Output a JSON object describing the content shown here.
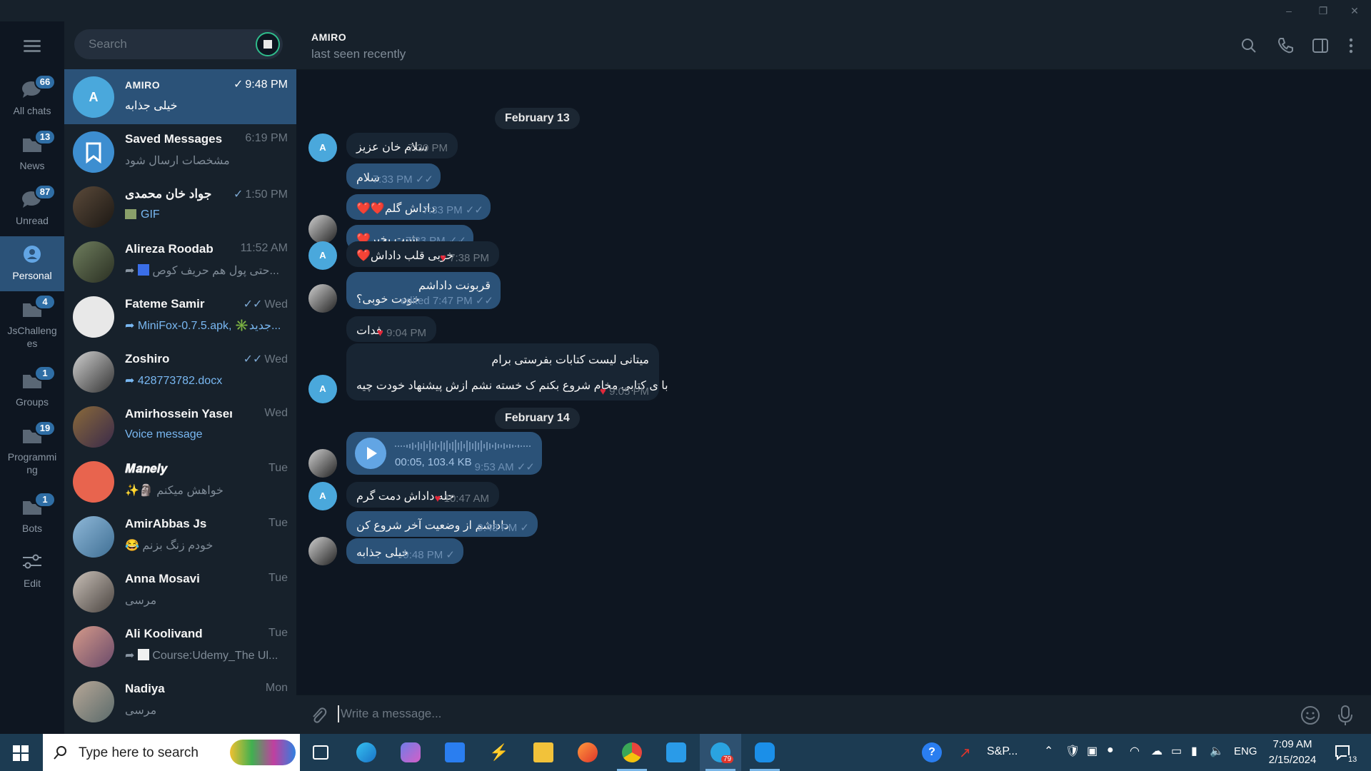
{
  "window": {
    "controls": {
      "minimize": "–",
      "maximize": "❐",
      "close": "✕"
    }
  },
  "folders": [
    {
      "label": "All chats",
      "badge": "66"
    },
    {
      "label": "News",
      "badge": "13"
    },
    {
      "label": "Unread",
      "badge": "87"
    },
    {
      "label": "Personal",
      "badge": ""
    },
    {
      "label": "JsChalleng es",
      "badge": "4"
    },
    {
      "label": "Groups",
      "badge": "1"
    },
    {
      "label": "Programmi ng",
      "badge": "19"
    },
    {
      "label": "Bots",
      "badge": "1"
    },
    {
      "label": "Edit",
      "badge": ""
    }
  ],
  "search": {
    "placeholder": "Search"
  },
  "chats": [
    {
      "name": "AMIRO",
      "time": "9:48 PM",
      "check": "✓",
      "preview": "خیلی جذابه",
      "avatar_letter": "A"
    },
    {
      "name": "Saved Messages",
      "time": "6:19 PM",
      "check": "",
      "preview": "مشخصات ارسال شود"
    },
    {
      "name": "جواد خان محمدی",
      "time": "1:50 PM",
      "check": "✓",
      "preview": "GIF"
    },
    {
      "name": "Alireza Roodab",
      "time": "11:52 AM",
      "check": "",
      "preview": "حتی پول هم حریف کوص..."
    },
    {
      "name": "Fateme Samir",
      "time": "Wed",
      "check": "✓✓",
      "preview": "MiniFox-0.7.5.apk, ✳️جدید..."
    },
    {
      "name": "Zoshiro",
      "time": "Wed",
      "check": "✓✓",
      "preview": "428773782.docx"
    },
    {
      "name": "Amirhossein Yasemy",
      "time": "Wed",
      "check": "",
      "preview": "Voice message"
    },
    {
      "name": "𝑴𝒂𝒏𝒆𝒍𝒚",
      "time": "Tue",
      "check": "",
      "preview": "خواهش میکنم 🗿✨"
    },
    {
      "name": "AmirAbbas Js",
      "time": "Tue",
      "check": "",
      "preview": "خودم زنگ بزنم 😂"
    },
    {
      "name": "Anna Mosavi",
      "time": "Tue",
      "check": "",
      "preview": "مرسی"
    },
    {
      "name": "Ali Koolivand",
      "time": "Tue",
      "check": "",
      "preview": "Course:Udemy_The Ul..."
    },
    {
      "name": "Nadiya",
      "time": "Mon",
      "check": "",
      "preview": "مرسی"
    }
  ],
  "peer": {
    "name": "AMIRO",
    "status": "last seen recently"
  },
  "messages": {
    "date1": "February 13",
    "date2": "February 14",
    "m1": {
      "text": "سلام خان عزیز",
      "time": "7:30 PM"
    },
    "m2": {
      "text": "سلام",
      "time": "7:33 PM"
    },
    "m3": {
      "text": "داداش گلم❤️❤️",
      "time": "7:33 PM"
    },
    "m4": {
      "text": "شبت بخیر❤️",
      "time": "7:33 PM"
    },
    "m5": {
      "text": "خوبی قلب داداش❤️",
      "time": "7:38 PM"
    },
    "m6": {
      "line1": "قربونت داداشم",
      "line2": "خودت خوبی؟",
      "time": "edited 7:47 PM"
    },
    "m7": {
      "text": "فدات",
      "time": "9:04 PM"
    },
    "m8": {
      "line1": "میتانی لیست کتابات بفرستی برام",
      "line2": "با ی کتابی مخام شروع بکنم ک خسته نشم ازش پیشنهاد خودت چیه",
      "time": "9:05 PM"
    },
    "m9": {
      "info": "00:05, 103.4 KB",
      "time": "9:53 AM"
    },
    "m10": {
      "text": "حله داداش دمت گرم",
      "time": "10:47 AM"
    },
    "m11": {
      "text": "داداشم از وضعیت آخر شروع کن",
      "time": "9:48 PM"
    },
    "m12": {
      "text": "خیلی جذابه",
      "time": "9:48 PM"
    }
  },
  "composer": {
    "placeholder": "Write a message..."
  },
  "taskbar": {
    "search_placeholder": "Type here to search",
    "stock": "S&P...",
    "lang": "ENG",
    "time": "7:09 AM",
    "date": "2/15/2024",
    "notif_count": "13",
    "telegram_badge": "79"
  },
  "colors": {
    "accent": "#2b5278",
    "sidebar": "#0e1621",
    "badge": "#2f6ea5",
    "heart": "#e0283a"
  }
}
